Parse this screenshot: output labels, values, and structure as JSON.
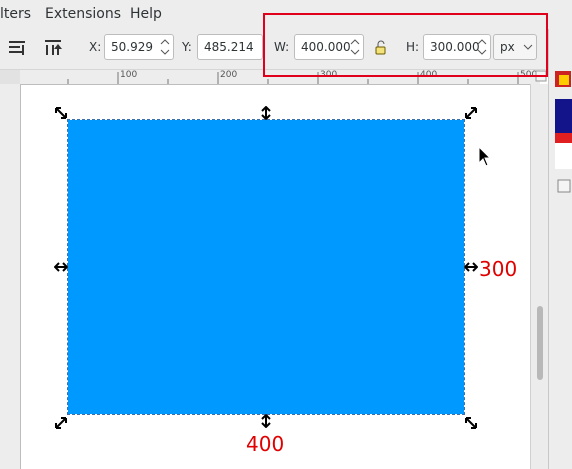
{
  "menubar": {
    "items": [
      "lters",
      "Extensions",
      "Help"
    ]
  },
  "toolbar": {
    "x_label": "X:",
    "x_value": "50.929",
    "y_label": "Y:",
    "y_value": "485.214",
    "w_label": "W:",
    "w_value": "400.000",
    "h_label": "H:",
    "h_value": "300.000",
    "unit": "px",
    "lock_icon": "lock-icon"
  },
  "ruler": {
    "ticks": [
      "100",
      "200",
      "300",
      "400",
      "500"
    ]
  },
  "canvas": {
    "rectangle_color": "#0099ff",
    "width_annotation": "400",
    "height_annotation": "300"
  },
  "highlight_color": "#e0001b"
}
